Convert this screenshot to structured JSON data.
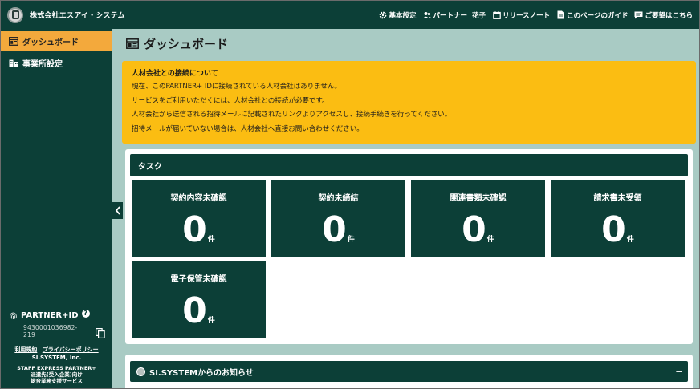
{
  "header": {
    "company": "株式会社エスアイ・システム",
    "nav": [
      {
        "icon": "gear-icon",
        "label": "基本設定"
      },
      {
        "icon": "users-icon",
        "label": "パートナー"
      }
    ],
    "user_name": "花子",
    "nav2": [
      {
        "icon": "calendar-icon",
        "label": "リリースノート"
      },
      {
        "icon": "document-icon",
        "label": "このページのガイド"
      },
      {
        "icon": "message-icon",
        "label": "ご要望はこちら"
      }
    ]
  },
  "sidebar": {
    "items": [
      {
        "icon": "dashboard-icon",
        "label": "ダッシュボード",
        "active": true
      },
      {
        "icon": "building-icon",
        "label": "事業所設定",
        "active": false
      }
    ],
    "partner_title": "PARTNER+ID",
    "partner_id": "9430001036982-219",
    "links": {
      "terms": "利用規約",
      "privacy": "プライバシーポリシー"
    },
    "copyright": "SI.SYSTEM, Inc.",
    "service_lines": [
      "STAFF EXPRESS PARTNER+",
      "派遣先(受入企業)向け",
      "総合業務支援サービス"
    ]
  },
  "main": {
    "title": "ダッシュボード",
    "alert": {
      "title": "人材会社との接続について",
      "lines": [
        "現在、このPARTNER+ IDに接続されている人材会社はありません。",
        "サービスをご利用いただくには、人材会社との接続が必要です。",
        "人材会社から送信される招待メールに記載されたリンクよりアクセスし、接続手続きを行ってください。",
        "招待メールが届いていない場合は、人材会社へ直接お問い合わせください。"
      ]
    },
    "tasks": {
      "title": "タスク",
      "unit": "件",
      "tiles": [
        {
          "label": "契約内容未確認",
          "count": "0"
        },
        {
          "label": "契約未締結",
          "count": "0"
        },
        {
          "label": "関連書類未確認",
          "count": "0"
        },
        {
          "label": "請求書未受領",
          "count": "0"
        },
        {
          "label": "電子保管未確認",
          "count": "0"
        }
      ]
    },
    "news": {
      "title": "SI.SYSTEMからのお知らせ",
      "toggle": "−"
    }
  },
  "colors": {
    "primary": "#0c3f37",
    "accent": "#f3a93c",
    "alert": "#fbbd12",
    "background": "#a9cbc4"
  }
}
